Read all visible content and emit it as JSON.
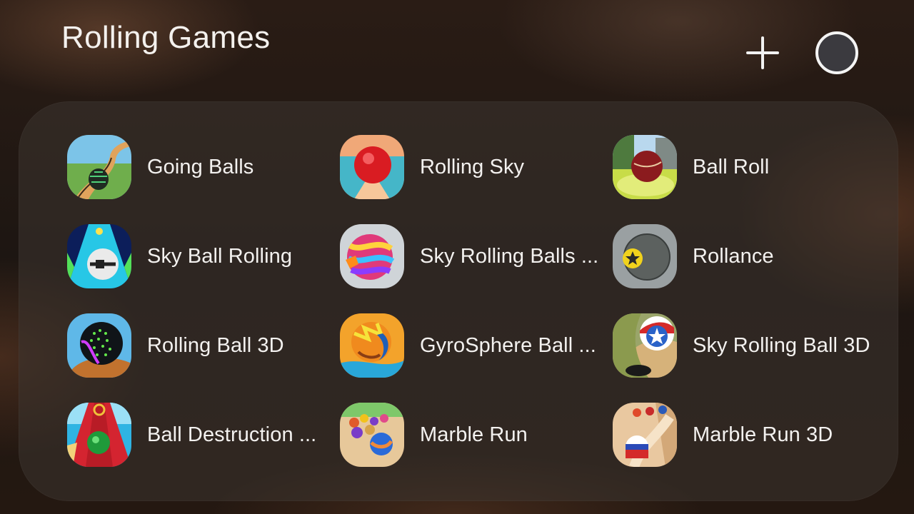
{
  "header": {
    "title": "Rolling Games"
  },
  "apps": [
    {
      "label": "Going Balls",
      "icon": "going-balls-icon"
    },
    {
      "label": "Rolling Sky",
      "icon": "rolling-sky-icon"
    },
    {
      "label": "Ball Roll",
      "icon": "ball-roll-icon"
    },
    {
      "label": "Sky Ball Rolling",
      "icon": "sky-ball-rolling-icon"
    },
    {
      "label": "Sky Rolling Balls ...",
      "icon": "sky-rolling-balls-icon"
    },
    {
      "label": "Rollance",
      "icon": "rollance-icon"
    },
    {
      "label": "Rolling Ball 3D",
      "icon": "rolling-ball-3d-icon"
    },
    {
      "label": "GyroSphere Ball ...",
      "icon": "gyrosphere-ball-icon"
    },
    {
      "label": "Sky Rolling Ball 3D",
      "icon": "sky-rolling-ball-3d-icon"
    },
    {
      "label": "Ball Destruction ...",
      "icon": "ball-destruction-icon"
    },
    {
      "label": "Marble Run",
      "icon": "marble-run-icon"
    },
    {
      "label": "Marble Run 3D",
      "icon": "marble-run-3d-icon"
    }
  ],
  "colors": {
    "text": "#f3f1ef",
    "panel": "#3c3430",
    "background": "#1d1612"
  }
}
